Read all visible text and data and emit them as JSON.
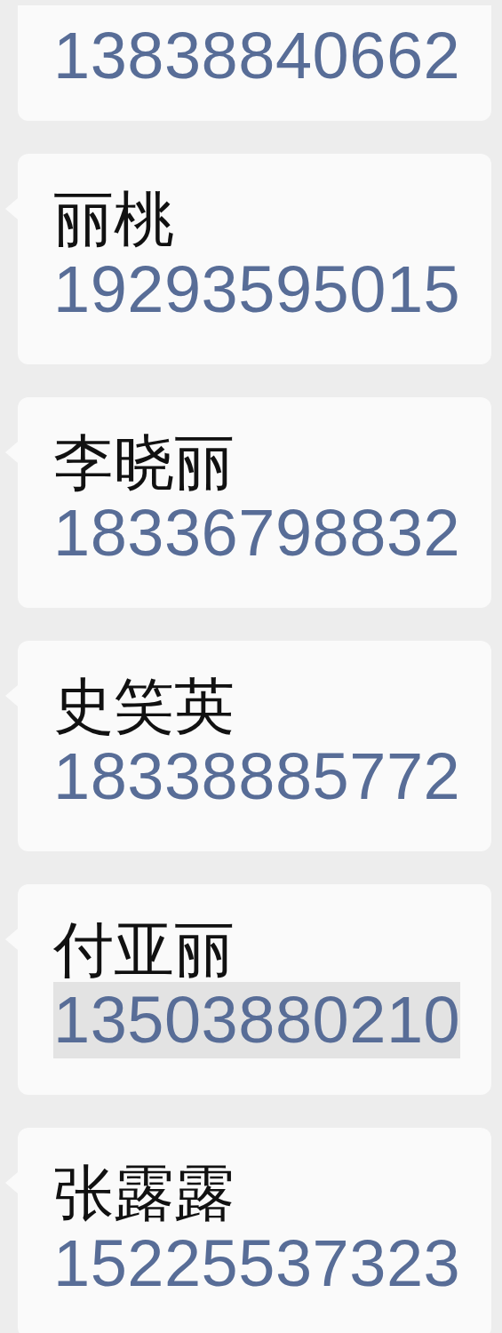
{
  "messages": [
    {
      "phone": "13838840662",
      "highlighted": false
    },
    {
      "name": "丽桃",
      "phone": "19293595015",
      "highlighted": false
    },
    {
      "name": "李晓丽",
      "phone": "18336798832",
      "highlighted": false
    },
    {
      "name": "史笑英",
      "phone": "18338885772",
      "highlighted": false
    },
    {
      "name": "付亚丽",
      "phone": "13503880210",
      "highlighted": true
    },
    {
      "name": "张露露",
      "phone": "15225537323",
      "highlighted": false
    }
  ]
}
